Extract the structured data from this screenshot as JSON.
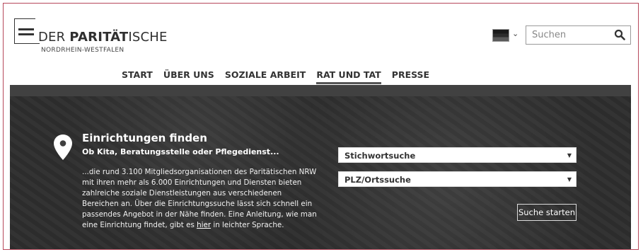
{
  "header": {
    "logo": {
      "brand_regular": "DER ",
      "brand_bold": "PARITÄT",
      "brand_tail": "ISCHE",
      "subline": "NORDRHEIN-WESTFALEN"
    },
    "language": {
      "selected_icon": "german-flag-icon"
    },
    "search": {
      "placeholder": "Suchen",
      "value": ""
    }
  },
  "nav": {
    "items": [
      {
        "label": "START"
      },
      {
        "label": "ÜBER UNS"
      },
      {
        "label": "SOZIALE ARBEIT"
      },
      {
        "label": "RAT UND TAT",
        "active": true
      },
      {
        "label": "PRESSE"
      }
    ]
  },
  "hero": {
    "title": "Einrichtungen finden",
    "subtitle": "Ob Kita, Beratungsstelle oder Pflegedienst...",
    "description_pre": "...die rund 3.100 Mitgliedsorganisationen des Paritätischen NRW mit ihren mehr als 6.000 Einrichtungen und Diensten bieten zahlreiche soziale Dienstleistungen aus verschiedenen Bereichen an. Über die Einrichtungssuche lässt sich schnell ein passendes Angebot in der Nähe finden. Eine Anleitung, wie man eine Einrichtung findet, gibt es ",
    "description_link": "hier",
    "description_post": " in leichter Sprache.",
    "select_keyword": "Stichwortsuche",
    "select_location": "PLZ/Ortssuche",
    "submit_label": "Suche starten"
  },
  "colors": {
    "frame_border": "#b7485b",
    "hero_bg": "#3f3f3f",
    "text_dark": "#333333"
  }
}
